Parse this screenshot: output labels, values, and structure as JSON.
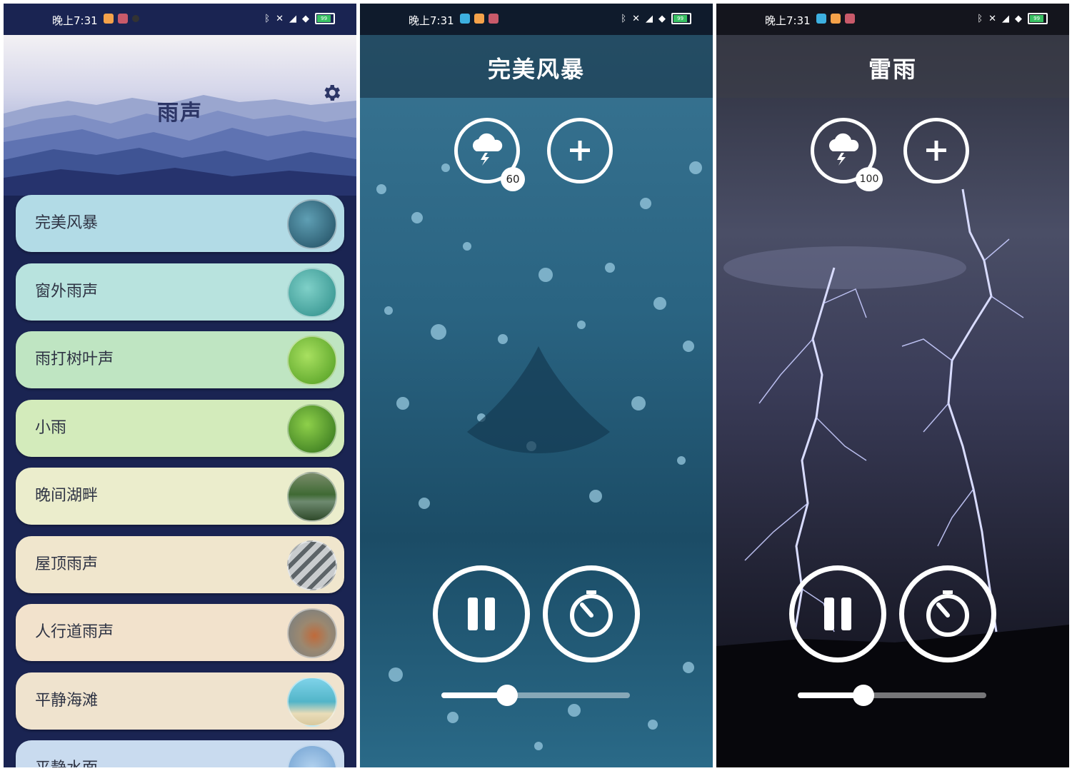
{
  "status_bar": {
    "time": "晚上7:31",
    "battery": "99"
  },
  "list_screen": {
    "title": "雨声",
    "settings_icon": "gear-icon",
    "items": [
      {
        "label": "完美风暴",
        "color": "#b2dbe6",
        "thumb": "#2d6b80"
      },
      {
        "label": "窗外雨声",
        "color": "#b8e3de",
        "thumb": "#4aa8a4"
      },
      {
        "label": "雨打树叶声",
        "color": "#bfe5c2",
        "thumb": "#6dbd2f"
      },
      {
        "label": "小雨",
        "color": "#d3ebbb",
        "thumb": "#4b9a2c"
      },
      {
        "label": "晚间湖畔",
        "color": "#ebedcc",
        "thumb": "#4c6b3a"
      },
      {
        "label": "屋顶雨声",
        "color": "#f0e6cd",
        "thumb": "#8d9295"
      },
      {
        "label": "人行道雨声",
        "color": "#f2e2cc",
        "thumb": "#9b8870"
      },
      {
        "label": "平静海滩",
        "color": "#efe3ce",
        "thumb": "#52b5c9"
      },
      {
        "label": "平静水面",
        "color": "#c9dbef",
        "thumb": "#8ab7e0"
      }
    ]
  },
  "players": [
    {
      "title": "完美风暴",
      "volume_badge": "60",
      "volume_level": 0.35,
      "add_icon": "plus-icon",
      "sound_icon": "thunder-cloud-icon",
      "pause_icon": "pause-icon",
      "timer_icon": "timer-icon"
    },
    {
      "title": "雷雨",
      "volume_badge": "100",
      "volume_level": 0.35,
      "add_icon": "plus-icon",
      "sound_icon": "thunder-cloud-icon",
      "pause_icon": "pause-icon",
      "timer_icon": "timer-icon"
    }
  ]
}
